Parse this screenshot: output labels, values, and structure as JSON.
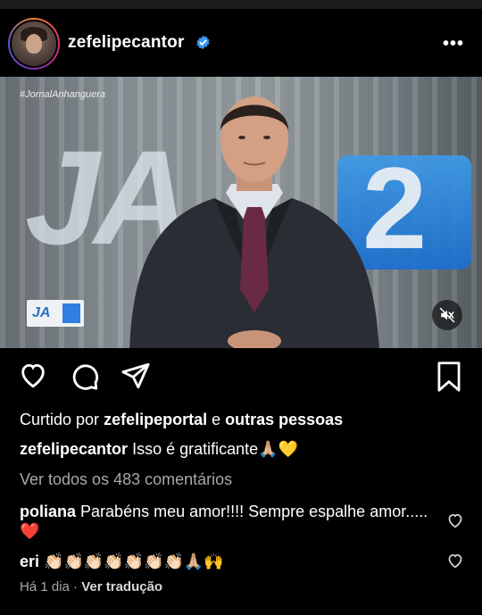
{
  "post": {
    "username": "zefelipecantor",
    "verified": true
  },
  "media": {
    "hashtag": "#JornalAnhanguera",
    "logo_text": "JA",
    "logo_number": "2",
    "badge_text": "JA"
  },
  "likes": {
    "prefix": "Curtido por",
    "user": "zefelipeportal",
    "connector": "e",
    "others": "outras pessoas"
  },
  "caption": {
    "username": "zefelipecantor",
    "text": "Isso é gratificante",
    "emojis": "🙏🏼💛"
  },
  "view_all_comments": "Ver todos os 483 comentários",
  "comments": [
    {
      "username": "poliana",
      "text": "Parabéns  meu amor!!!! Sempre espalhe amor.....",
      "emojis": "❤️"
    },
    {
      "username": "eri",
      "text": "",
      "emojis": "👏🏻👏🏻👏🏻👏🏻👏🏻👏🏻👏🏻🙏🏼🙌"
    }
  ],
  "meta": {
    "time": "Há 1 dia",
    "separator": "·",
    "translate": "Ver tradução"
  },
  "icons": {
    "like": "heart-icon",
    "comment": "comment-icon",
    "share": "paper-plane-icon",
    "save": "bookmark-icon",
    "more": "more-options-icon",
    "mute": "muted-speaker-icon"
  },
  "colors": {
    "background": "#000000",
    "muted_text": "#a8a8a8",
    "verified": "#3897f0"
  }
}
